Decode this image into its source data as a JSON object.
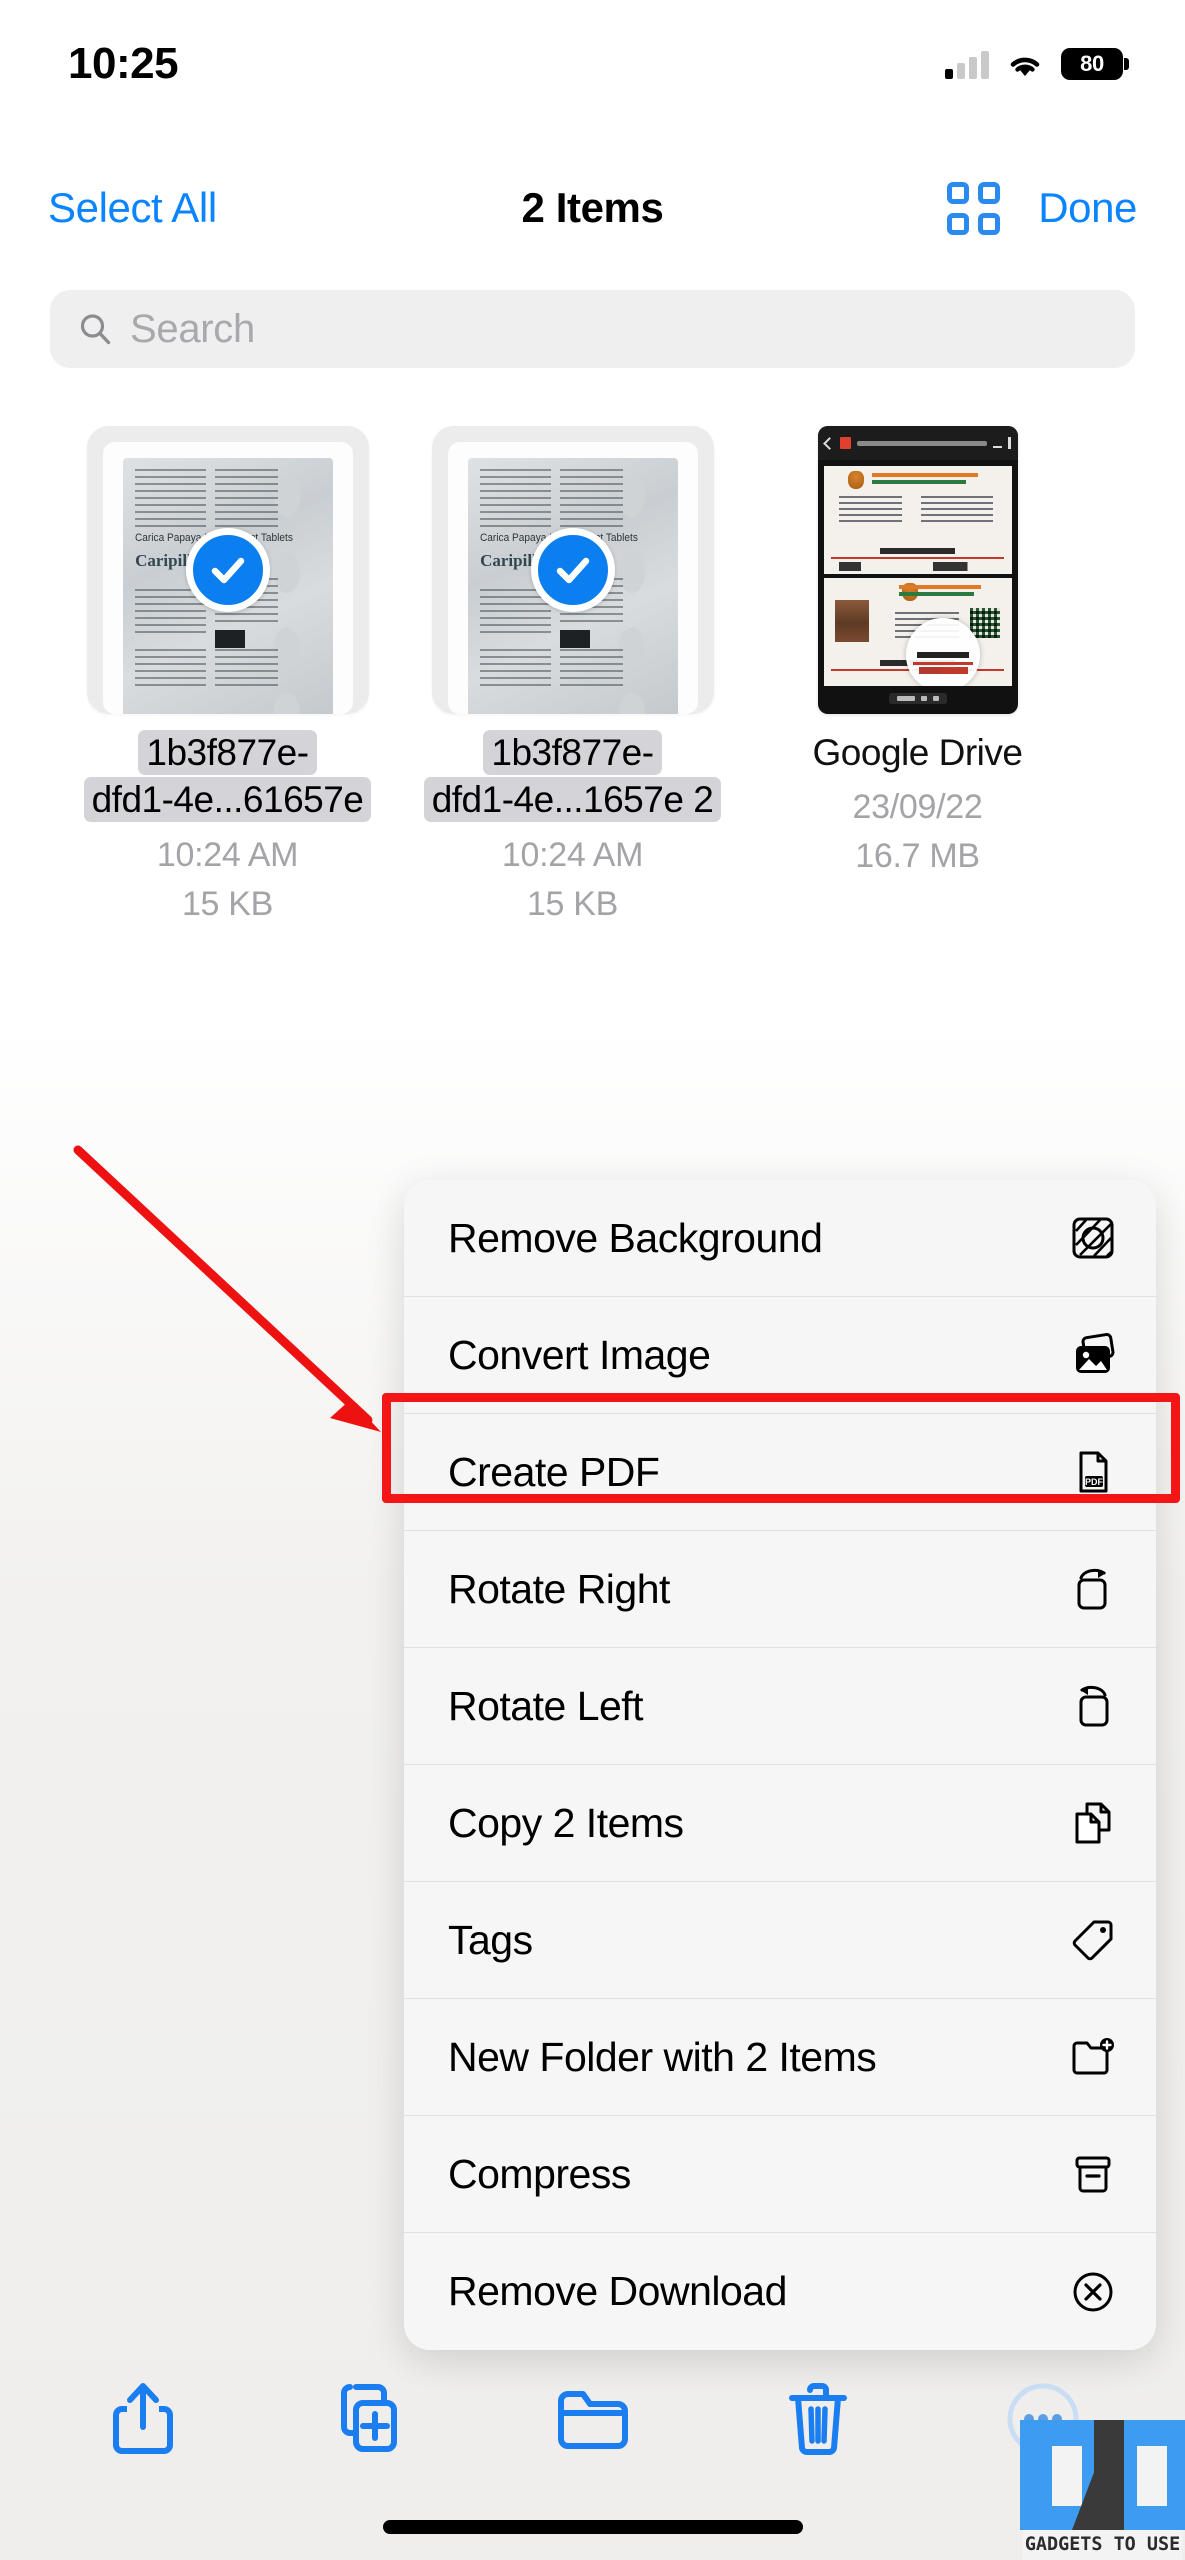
{
  "status_bar": {
    "time": "10:25",
    "battery_level": "80",
    "cellular_icon": "cellular-signal-icon",
    "wifi_icon": "wifi-icon",
    "battery_icon": "battery-icon"
  },
  "nav_bar": {
    "select_all_label": "Select All",
    "title": "2 Items",
    "grid_view_icon": "grid-view-icon",
    "done_label": "Done",
    "accent_color": "#0a84ff"
  },
  "search": {
    "placeholder": "Search",
    "icon": "search-icon"
  },
  "files": [
    {
      "name_line1": "1b3f877e-",
      "name_line2": "dfd1-4e...61657e",
      "time": "10:24 AM",
      "size": "15 KB",
      "selected": true,
      "thumbnail": "pill-blister-pack-photo",
      "thumb_text_1": "Carica Papaya Leaf Extract Tablets",
      "thumb_brand": "Caripill"
    },
    {
      "name_line1": "1b3f877e-",
      "name_line2": "dfd1-4e...1657e 2",
      "time": "10:24 AM",
      "size": "15 KB",
      "selected": true,
      "thumbnail": "pill-blister-pack-photo",
      "thumb_text_1": "Carica Papaya Leaf Extract Tablets",
      "thumb_brand": "Caripill"
    },
    {
      "name_line1": "Google Drive",
      "name_line2": "",
      "time": "23/09/22",
      "size": "16.7 MB",
      "selected": false,
      "thumbnail": "google-drive-pdf-screenshot"
    }
  ],
  "context_menu": {
    "items": [
      {
        "label": "Remove Background",
        "icon": "remove-background-icon"
      },
      {
        "label": "Convert Image",
        "icon": "convert-image-icon"
      },
      {
        "label": "Create PDF",
        "icon": "create-pdf-icon",
        "highlighted": true
      },
      {
        "label": "Rotate Right",
        "icon": "rotate-right-icon"
      },
      {
        "label": "Rotate Left",
        "icon": "rotate-left-icon"
      },
      {
        "label": "Copy 2 Items",
        "icon": "copy-icon"
      },
      {
        "label": "Tags",
        "icon": "tag-icon"
      },
      {
        "label": "New Folder with 2 Items",
        "icon": "new-folder-icon"
      },
      {
        "label": "Compress",
        "icon": "compress-icon"
      },
      {
        "label": "Remove Download",
        "icon": "remove-download-icon"
      }
    ]
  },
  "annotation": {
    "highlight_color": "#f41616",
    "arrow_icon": "red-arrow-pointer",
    "highlight_target": "Create PDF"
  },
  "toolbar": {
    "items": [
      {
        "icon": "share-icon",
        "name": "share-button"
      },
      {
        "icon": "duplicate-icon",
        "name": "duplicate-button"
      },
      {
        "icon": "folder-icon",
        "name": "move-to-folder-button"
      },
      {
        "icon": "trash-icon",
        "name": "delete-button"
      },
      {
        "icon": "more-ellipsis-icon",
        "name": "more-button"
      }
    ]
  },
  "watermark": {
    "text": "GADGETS TO USE",
    "logo_color": "#3d9bf0"
  }
}
